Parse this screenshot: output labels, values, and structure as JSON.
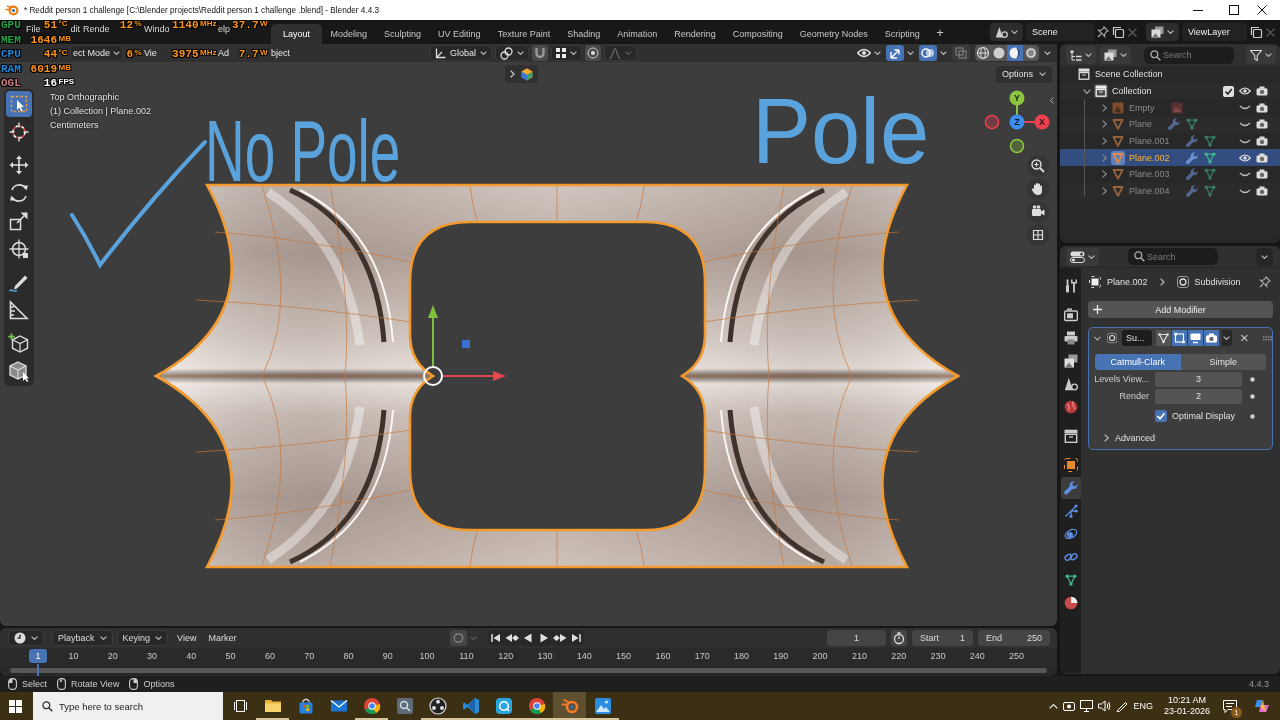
{
  "window": {
    "title": "* Reddit person 1 challenge [C:\\Blender projects\\Reddit person 1 challenge .blend] - Blender 4.4.3"
  },
  "topbar": {
    "menus": [
      "File",
      "dit",
      "Rende",
      "Windo",
      "elp"
    ],
    "workspaces": [
      {
        "label": "Layout",
        "selected": true
      },
      {
        "label": "Modeling",
        "selected": false
      },
      {
        "label": "Sculpting",
        "selected": false
      },
      {
        "label": "UV Editing",
        "selected": false
      },
      {
        "label": "Texture Paint",
        "selected": false
      },
      {
        "label": "Shading",
        "selected": false
      },
      {
        "label": "Animation",
        "selected": false
      },
      {
        "label": "Rendering",
        "selected": false
      },
      {
        "label": "Compositing",
        "selected": false
      },
      {
        "label": "Geometry Nodes",
        "selected": false
      },
      {
        "label": "Scripting",
        "selected": false
      }
    ],
    "add_workspace": "+",
    "scene": "Scene",
    "view_layer": "ViewLayer"
  },
  "performance_overlay": {
    "rows": [
      {
        "label": "GPU",
        "color": "#22a24a",
        "readings": [
          {
            "kind": "temperature",
            "value": "51",
            "unit": "°C"
          },
          {
            "kind": "load",
            "value": "12",
            "unit": "%"
          },
          {
            "kind": "clock",
            "value": "1140",
            "unit": "MHz"
          },
          {
            "kind": "power",
            "value": "37.7",
            "unit": "W"
          }
        ]
      },
      {
        "label": "MEM",
        "color": "#22a24a",
        "readings": [
          {
            "kind": "memory",
            "value": "1646",
            "unit": "MB"
          }
        ]
      },
      {
        "label": "CPU",
        "color": "#1f88dc",
        "readings": [
          {
            "kind": "temperature",
            "value": "44",
            "unit": "°C"
          },
          {
            "kind": "load",
            "value": "6",
            "unit": "%"
          },
          {
            "kind": "clock",
            "value": "3975",
            "unit": "MHz"
          },
          {
            "kind": "power",
            "value": "7.7",
            "unit": "W"
          }
        ]
      },
      {
        "label": "RAM",
        "color": "#1f88dc",
        "readings": [
          {
            "kind": "memory",
            "value": "6019",
            "unit": "MB"
          }
        ]
      },
      {
        "label": "OGL",
        "color": "#d07c7c",
        "readings": [
          {
            "kind": "framerate",
            "value": "16",
            "unit": "FPS"
          }
        ]
      }
    ]
  },
  "viewport": {
    "header": {
      "mode": "ect Mode",
      "menus": [
        "Vie",
        "Ad",
        "bject"
      ],
      "orientation": "Global",
      "toggles": [
        {
          "kind": "gizmos",
          "on": true
        },
        {
          "kind": "overlays",
          "on": true
        },
        {
          "kind": "xray",
          "on": false
        }
      ],
      "shading": [
        {
          "kind": "wireframe",
          "selected": false
        },
        {
          "kind": "solid",
          "selected": false
        },
        {
          "kind": "material",
          "selected": true
        },
        {
          "kind": "rendered",
          "selected": false
        }
      ]
    },
    "options": "Options",
    "info": [
      "Top Orthographic",
      "(1) Collection | Plane.002",
      "Centimeters"
    ],
    "tools": [
      {
        "kind": "select_box",
        "selected": true
      },
      {
        "kind": "cursor",
        "selected": false
      },
      {
        "kind": "move",
        "selected": false
      },
      {
        "kind": "rotate",
        "selected": false
      },
      {
        "kind": "scale",
        "selected": false
      },
      {
        "kind": "transform",
        "selected": false
      },
      {
        "kind": "annotate",
        "selected": false
      },
      {
        "kind": "measure",
        "selected": false
      },
      {
        "kind": "add_cube",
        "selected": false
      },
      {
        "kind": "add_object",
        "selected": false
      }
    ],
    "gizmo_axes": [
      {
        "label": "Y",
        "color": "#8bc540"
      },
      {
        "label": "X",
        "color": "#f0404f"
      },
      {
        "label": "Z",
        "color": "#3a8ef0"
      }
    ],
    "annotations": [
      "No Pole",
      "Pole"
    ]
  },
  "outliner": {
    "search": {
      "placeholder": "Search"
    },
    "tree": [
      {
        "name": "Scene Collection",
        "kind": "scene_collection",
        "selected": false,
        "children": [
          {
            "name": "Collection",
            "kind": "collection",
            "expanded": true,
            "checked": true,
            "visible": true,
            "selected": false,
            "children": [
              {
                "name": "Empty",
                "kind": "empty",
                "extras": [
                  {
                    "kind": "image"
                  }
                ],
                "expanded": false,
                "visible": false,
                "selected": false
              },
              {
                "name": "Plane",
                "kind": "mesh",
                "extras": [
                  {
                    "kind": "modifier"
                  },
                  {
                    "kind": "mesh_data"
                  }
                ],
                "expanded": false,
                "visible": false,
                "selected": false
              },
              {
                "name": "Plane.001",
                "kind": "mesh",
                "extras": [
                  {
                    "kind": "modifier"
                  },
                  {
                    "kind": "mesh_data"
                  }
                ],
                "expanded": false,
                "visible": false,
                "selected": false
              },
              {
                "name": "Plane.002",
                "kind": "mesh",
                "extras": [
                  {
                    "kind": "modifier"
                  },
                  {
                    "kind": "mesh_data"
                  }
                ],
                "expanded": false,
                "visible": true,
                "selected": true
              },
              {
                "name": "Plane.003",
                "kind": "mesh",
                "extras": [
                  {
                    "kind": "modifier"
                  },
                  {
                    "kind": "mesh_data"
                  }
                ],
                "expanded": false,
                "visible": false,
                "selected": false
              },
              {
                "name": "Plane.004",
                "kind": "mesh",
                "extras": [
                  {
                    "kind": "modifier"
                  },
                  {
                    "kind": "mesh_data"
                  }
                ],
                "expanded": false,
                "visible": false,
                "selected": false
              }
            ]
          }
        ]
      }
    ]
  },
  "properties": {
    "search": {
      "placeholder": "Search"
    },
    "tabs": [
      {
        "kind": "tool",
        "selected": false
      },
      {
        "kind": "render",
        "selected": false
      },
      {
        "kind": "output",
        "selected": false
      },
      {
        "kind": "view_layer",
        "selected": false
      },
      {
        "kind": "scene",
        "selected": false
      },
      {
        "kind": "world",
        "selected": false
      },
      {
        "kind": "collection",
        "selected": false
      },
      {
        "kind": "object",
        "selected": false
      },
      {
        "kind": "modifiers",
        "selected": true
      },
      {
        "kind": "particles",
        "selected": false
      },
      {
        "kind": "physics",
        "selected": false
      },
      {
        "kind": "constraints",
        "selected": false
      },
      {
        "kind": "data",
        "selected": false
      },
      {
        "kind": "material",
        "selected": false
      }
    ],
    "breadcrumb": [
      {
        "kind": "object",
        "label": "Plane.002"
      },
      {
        "kind": "modifier",
        "label": "Subdivision"
      }
    ],
    "add_modifier": "Add Modifier",
    "modifier": {
      "name": "Su...",
      "expanded": true,
      "toggles": [
        {
          "kind": "edit_mode",
          "on": false
        },
        {
          "kind": "on_cage",
          "on": true
        },
        {
          "kind": "viewport",
          "on": true
        },
        {
          "kind": "render",
          "on": true
        }
      ],
      "methods": [
        {
          "label": "Catmull-Clark",
          "selected": true
        },
        {
          "label": "Simple",
          "selected": false
        }
      ],
      "fields": [
        {
          "label": "Levels View...",
          "value": "3"
        },
        {
          "label": "Render",
          "value": "2"
        }
      ],
      "optimal_display": {
        "label": "Optimal Display",
        "checked": true
      },
      "advanced": {
        "label": "Advanced",
        "expanded": false
      }
    }
  },
  "timeline": {
    "menus": [
      {
        "label": "Playback",
        "kind": "dropdown"
      },
      {
        "label": "Keying",
        "kind": "dropdown"
      },
      {
        "label": "View",
        "kind": "menu"
      },
      {
        "label": "Marker",
        "kind": "menu"
      }
    ],
    "auto_keying": {
      "on": false
    },
    "current_frame": "1",
    "start": {
      "label": "Start",
      "value": "1"
    },
    "end": {
      "label": "End",
      "value": "250"
    },
    "ruler": {
      "current": "1",
      "labels": [
        "10",
        "20",
        "30",
        "40",
        "50",
        "60",
        "70",
        "80",
        "90",
        "100",
        "110",
        "120",
        "130",
        "140",
        "150",
        "160",
        "170",
        "180",
        "190",
        "200",
        "210",
        "220",
        "230",
        "240",
        "250"
      ]
    }
  },
  "status_bar": {
    "hints": [
      {
        "kind": "left_click",
        "label": "Select"
      },
      {
        "kind": "middle_click",
        "label": "Rotate View"
      },
      {
        "kind": "right_click",
        "label": "Options"
      }
    ],
    "version": "4.4.3"
  },
  "taskbar": {
    "search": {
      "placeholder": "Type here to search"
    },
    "apps": [
      {
        "kind": "folder",
        "running": true,
        "selected": false
      },
      {
        "kind": "store",
        "running": false,
        "selected": false
      },
      {
        "kind": "mail",
        "running": false,
        "selected": false
      },
      {
        "kind": "browser",
        "running": true,
        "selected": false
      },
      {
        "kind": "magnifier_app",
        "running": false,
        "selected": false
      },
      {
        "kind": "camera_app",
        "running": true,
        "selected": false
      },
      {
        "kind": "code_editor",
        "running": true,
        "selected": false
      },
      {
        "kind": "chat",
        "running": true,
        "selected": false
      },
      {
        "kind": "browser",
        "running": true,
        "selected": false
      },
      {
        "kind": "blender",
        "running": true,
        "selected": true
      },
      {
        "kind": "photos",
        "running": true,
        "selected": false
      }
    ],
    "language": "ENG",
    "time": "10:21 AM",
    "date": "23-01-2026",
    "notifications": "1"
  }
}
